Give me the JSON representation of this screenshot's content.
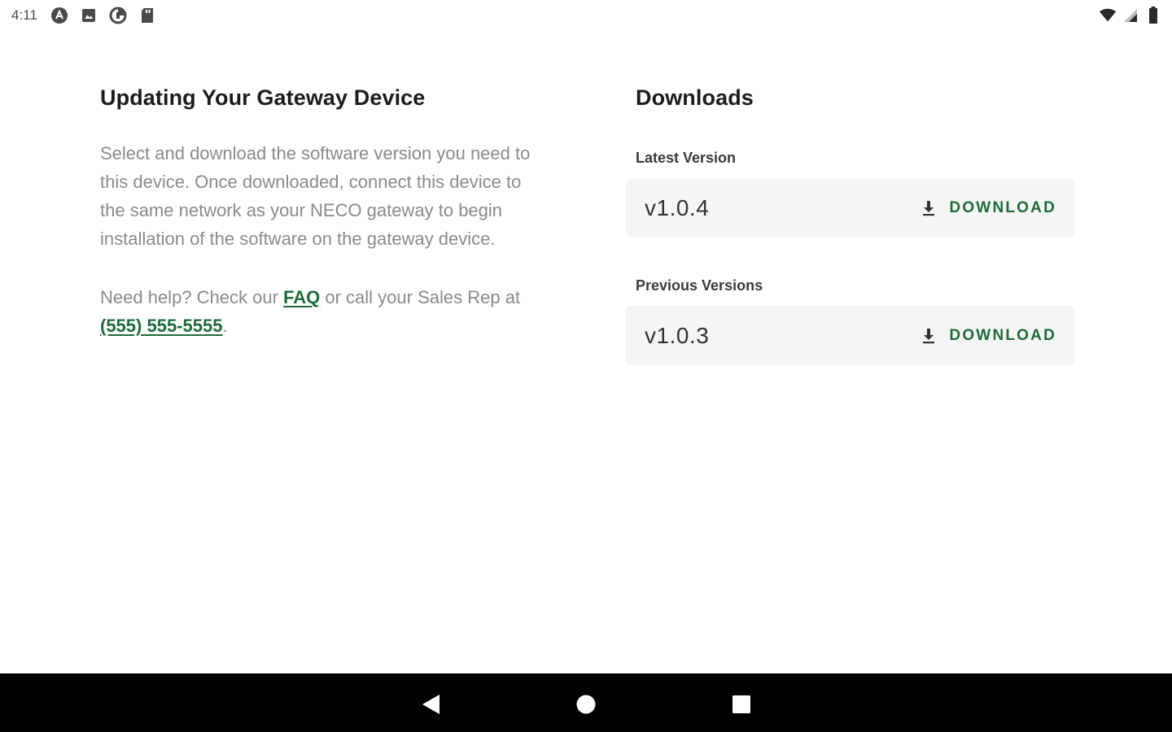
{
  "status_bar": {
    "time": "4:11",
    "left_icons": [
      "app-a-icon",
      "photo-icon",
      "data-saver-icon",
      "sd-card-icon"
    ],
    "right_icons": [
      "wifi-icon",
      "cell-signal-icon",
      "battery-icon"
    ]
  },
  "info": {
    "title": "Updating Your Gateway Device",
    "description": "Select and download the software version you need to this device. Once downloaded, connect this device to the same network as your NECO gateway to begin installation of the software on the gateway device.",
    "help_prefix": "Need help? Check our ",
    "faq_link": "FAQ",
    "help_middle": " or call your Sales Rep at ",
    "phone_link": "(555) 555-5555",
    "help_suffix": "."
  },
  "downloads": {
    "title": "Downloads",
    "latest_label": "Latest Version",
    "latest_version": "v1.0.4",
    "previous_label": "Previous Versions",
    "previous_versions": [
      "v1.0.3"
    ],
    "download_label": "DOWNLOAD"
  },
  "colors": {
    "accent": "#1e6b3a",
    "card_bg": "#f5f5f5",
    "nav_bar_bg": "#000000"
  },
  "nav_bar": {
    "buttons": [
      "back-icon",
      "home-icon",
      "recents-icon"
    ]
  }
}
